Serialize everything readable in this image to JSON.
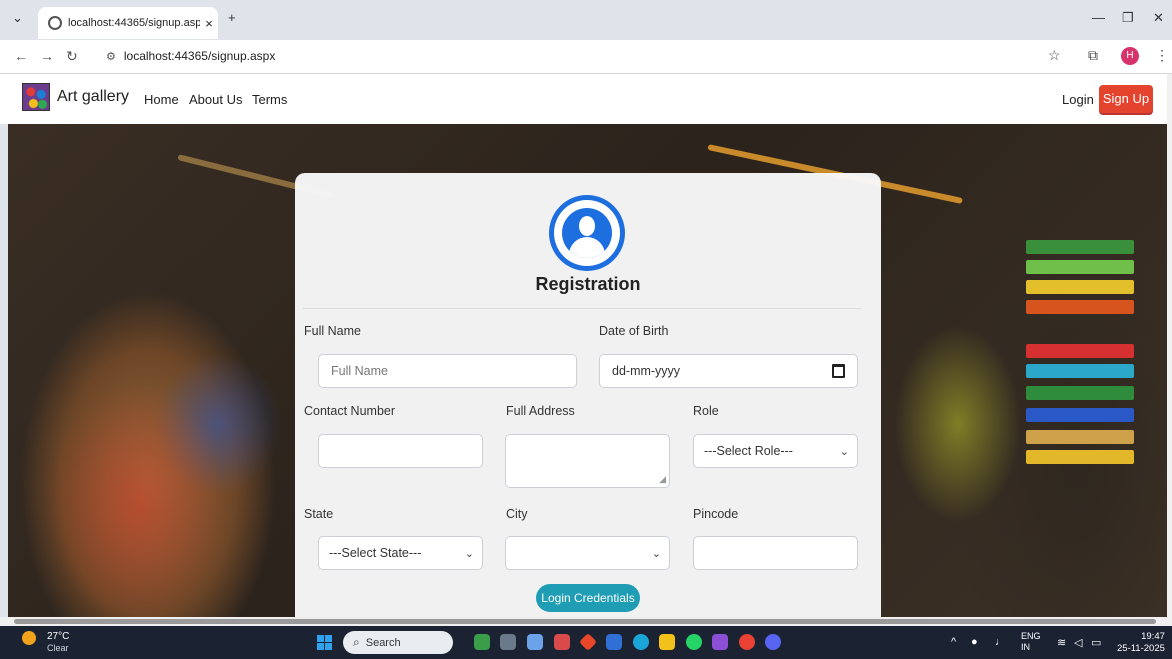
{
  "browser": {
    "tab_title": "localhost:44365/signup.aspx",
    "url": "localhost:44365/signup.aspx",
    "profile_initial": "H"
  },
  "site": {
    "brand": "Art gallery",
    "nav": [
      "Home",
      "About Us",
      "Terms"
    ],
    "login": "Login",
    "signup": "Sign Up"
  },
  "form": {
    "title": "Registration",
    "full_name_label": "Full Name",
    "full_name_placeholder": "Full Name",
    "dob_label": "Date of Birth",
    "dob_value": "dd-mm-yyyy",
    "contact_label": "Contact Number",
    "address_label": "Full Address",
    "role_label": "Role",
    "role_value": "---Select Role---",
    "state_label": "State",
    "state_value": "---Select State---",
    "city_label": "City",
    "city_value": "",
    "pincode_label": "Pincode",
    "login_credentials": "Login Credentials"
  },
  "taskbar": {
    "weather_temp": "27°C",
    "weather_desc": "Clear",
    "search": "Search",
    "lang": "ENG",
    "region": "IN",
    "time": "19:47",
    "date": "25-11-2025"
  },
  "colors": {
    "signup_button": "#e4442d",
    "login_credentials_button": "#1e9db5",
    "profile_icon": "#1d6fe0"
  }
}
